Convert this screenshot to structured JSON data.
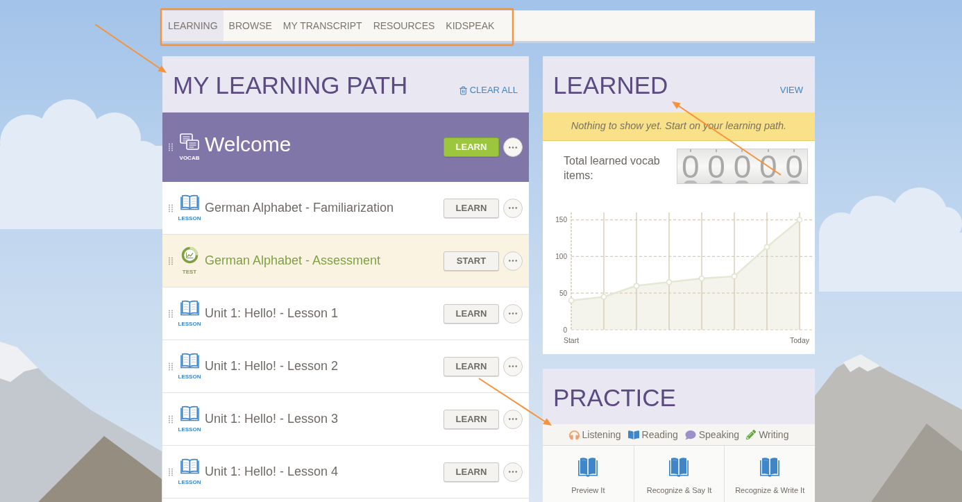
{
  "nav": {
    "tabs": [
      {
        "label": "LEARNING",
        "selected": true
      },
      {
        "label": "BROWSE",
        "selected": false
      },
      {
        "label": "MY TRANSCRIPT",
        "selected": false
      },
      {
        "label": "RESOURCES",
        "selected": false
      },
      {
        "label": "KIDSPEAK",
        "selected": false
      }
    ]
  },
  "learning_path": {
    "title": "MY LEARNING PATH",
    "clear_all": "CLEAR ALL",
    "items": [
      {
        "kind": "vocab",
        "type_label": "VOCAB",
        "title": "Welcome",
        "button": "LEARN",
        "selected": true
      },
      {
        "kind": "lesson",
        "type_label": "LESSON",
        "title": "German Alphabet - Familiarization",
        "button": "LEARN",
        "selected": false
      },
      {
        "kind": "test",
        "type_label": "TEST",
        "title": "German Alphabet - Assessment",
        "button": "START",
        "selected": false
      },
      {
        "kind": "lesson",
        "type_label": "LESSON",
        "title": "Unit 1: Hello! - Lesson 1",
        "button": "LEARN",
        "selected": false
      },
      {
        "kind": "lesson",
        "type_label": "LESSON",
        "title": "Unit 1: Hello! - Lesson 2",
        "button": "LEARN",
        "selected": false
      },
      {
        "kind": "lesson",
        "type_label": "LESSON",
        "title": "Unit 1: Hello! - Lesson 3",
        "button": "LEARN",
        "selected": false
      },
      {
        "kind": "lesson",
        "type_label": "LESSON",
        "title": "Unit 1: Hello! - Lesson 4",
        "button": "LEARN",
        "selected": false
      }
    ]
  },
  "learned": {
    "title": "LEARNED",
    "view_link": "VIEW",
    "notice": "Nothing to show yet. Start on your learning path.",
    "total_label": "Total learned vocab items:",
    "counter_digits": [
      "0",
      "0",
      "0",
      "0",
      "0"
    ],
    "chart_data": {
      "type": "area",
      "categories": [
        "Start",
        null,
        null,
        null,
        null,
        null,
        null,
        "Today"
      ],
      "values": [
        40,
        45,
        60,
        65,
        70,
        73,
        113,
        150
      ],
      "ylim": [
        0,
        160
      ],
      "yticks": [
        0,
        50,
        100,
        150
      ],
      "grid": true
    }
  },
  "practice": {
    "title": "PRACTICE",
    "skills": [
      {
        "kind": "listening",
        "label": "Listening"
      },
      {
        "kind": "reading",
        "label": "Reading"
      },
      {
        "kind": "speaking",
        "label": "Speaking"
      },
      {
        "kind": "writing",
        "label": "Writing"
      }
    ],
    "activities": [
      "Preview It",
      "Recognize & Say It",
      "Recognize & Write It"
    ]
  }
}
